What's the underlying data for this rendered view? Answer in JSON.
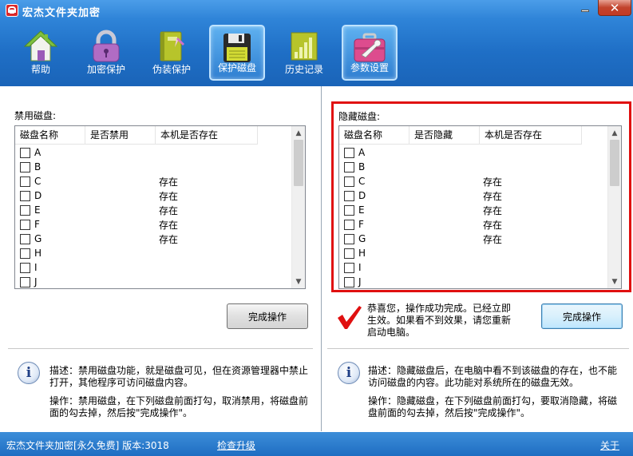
{
  "window": {
    "title": "宏杰文件夹加密",
    "minimize_icon": "minimize-icon",
    "close_icon": "close-icon"
  },
  "toolbar": {
    "items": [
      {
        "label": "帮助",
        "icon": "house-icon",
        "active": false
      },
      {
        "label": "加密保护",
        "icon": "padlock-icon",
        "active": false
      },
      {
        "label": "伪装保护",
        "icon": "notebook-icon",
        "active": false
      },
      {
        "label": "保护磁盘",
        "icon": "floppy-disk-icon",
        "active": true
      },
      {
        "label": "历史记录",
        "icon": "bar-chart-icon",
        "active": false
      },
      {
        "label": "参数设置",
        "icon": "toolbox-icon",
        "active": false
      }
    ]
  },
  "disable_panel": {
    "label": "禁用磁盘:",
    "columns": [
      "磁盘名称",
      "是否禁用",
      "本机是否存在"
    ],
    "rows": [
      {
        "name": "A",
        "flag": "",
        "exists": ""
      },
      {
        "name": "B",
        "flag": "",
        "exists": ""
      },
      {
        "name": "C",
        "flag": "",
        "exists": "存在"
      },
      {
        "name": "D",
        "flag": "",
        "exists": "存在"
      },
      {
        "name": "E",
        "flag": "",
        "exists": "存在"
      },
      {
        "name": "F",
        "flag": "",
        "exists": "存在"
      },
      {
        "name": "G",
        "flag": "",
        "exists": "存在"
      },
      {
        "name": "H",
        "flag": "",
        "exists": ""
      },
      {
        "name": "I",
        "flag": "",
        "exists": ""
      },
      {
        "name": "J",
        "flag": "",
        "exists": ""
      }
    ],
    "button_label": "完成操作",
    "description": "描述：禁用磁盘功能，就是磁盘可见，但在资源管理器中禁止打开，其他程序可访问磁盘内容。",
    "operation": "操作：禁用磁盘，在下列磁盘前面打勾，取消禁用，将磁盘前面的勾去掉，然后按\"完成操作\"。"
  },
  "hide_panel": {
    "label": "隐藏磁盘:",
    "columns": [
      "磁盘名称",
      "是否隐藏",
      "本机是否存在"
    ],
    "rows": [
      {
        "name": "A",
        "flag": "",
        "exists": ""
      },
      {
        "name": "B",
        "flag": "",
        "exists": ""
      },
      {
        "name": "C",
        "flag": "",
        "exists": "存在"
      },
      {
        "name": "D",
        "flag": "",
        "exists": "存在"
      },
      {
        "name": "E",
        "flag": "",
        "exists": "存在"
      },
      {
        "name": "F",
        "flag": "",
        "exists": "存在"
      },
      {
        "name": "G",
        "flag": "",
        "exists": "存在"
      },
      {
        "name": "H",
        "flag": "",
        "exists": ""
      },
      {
        "name": "I",
        "flag": "",
        "exists": ""
      },
      {
        "name": "J",
        "flag": "",
        "exists": ""
      }
    ],
    "button_label": "完成操作",
    "success_message": "恭喜您，操作成功完成。已经立即生效。如果看不到效果，请您重新启动电脑。",
    "description": "描述：隐藏磁盘后，在电脑中看不到该磁盘的存在，也不能访问磁盘的内容。此功能对系统所在的磁盘无效。",
    "operation": "操作：隐藏磁盘，在下列磁盘前面打勾，要取消隐藏，将磁盘前面的勾去掉，然后按\"完成操作\"。"
  },
  "statusbar": {
    "info": "宏杰文件夹加密[永久免费]  版本:3018",
    "upgrade_link": "检查升级",
    "close_link": "关于"
  },
  "colors": {
    "accent": "#1f6fc6",
    "highlight_frame": "#e01010",
    "success_check": "#e01010"
  }
}
